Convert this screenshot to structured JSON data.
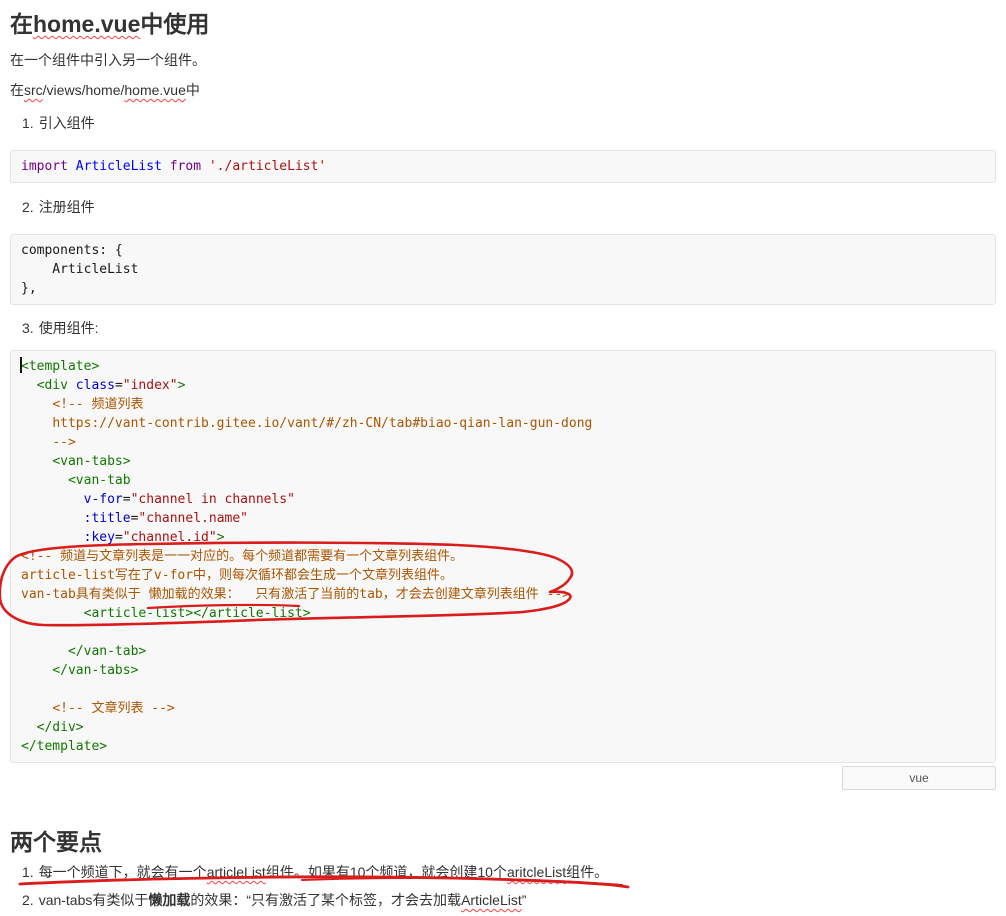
{
  "colors": {
    "annotation_red": "#d91c1c",
    "squiggle_red": "#ff4242",
    "code_bg": "#f8f8f8"
  },
  "sections": {
    "top": {
      "title_segments": [
        {
          "text": "在"
        },
        {
          "text": "home.vue",
          "squiggle": true
        },
        {
          "text": "中使用"
        }
      ],
      "intro": "在一个组件中引入另一个组件。",
      "path_segments": [
        {
          "text": "在"
        },
        {
          "text": "src",
          "squiggle": true
        },
        {
          "text": "/views/home/"
        },
        {
          "text": "home.vue",
          "squiggle": true
        },
        {
          "text": "中"
        }
      ],
      "steps": [
        {
          "marker": "1.",
          "label": "引入组件"
        },
        {
          "marker": "2.",
          "label": "注册组件"
        },
        {
          "marker": "3.",
          "label": "使用组件:"
        }
      ]
    },
    "code_blocks": {
      "import_block": {
        "lines": [
          [
            [
              "kw",
              "import"
            ],
            [
              "pl",
              " "
            ],
            [
              "def",
              "ArticleList"
            ],
            [
              "pl",
              " "
            ],
            [
              "kw",
              "from"
            ],
            [
              "pl",
              " "
            ],
            [
              "str",
              "'./articleList'"
            ]
          ]
        ]
      },
      "components_block": {
        "lines": [
          [
            [
              "pl",
              "components: {"
            ]
          ],
          [
            [
              "pl",
              "    ArticleList"
            ]
          ],
          [
            [
              "pl",
              "},"
            ]
          ]
        ]
      },
      "template_block": {
        "language_label": "vue",
        "lines": [
          [
            [
              "tag",
              "<template>"
            ]
          ],
          [
            [
              "pl",
              "  "
            ],
            [
              "tag",
              "<div"
            ],
            [
              "pl",
              " "
            ],
            [
              "attr",
              "class"
            ],
            [
              "pl",
              "="
            ],
            [
              "str",
              "\"index\""
            ],
            [
              "tag",
              ">"
            ]
          ],
          [
            [
              "pl",
              "    "
            ],
            [
              "com",
              "<!-- 频道列表"
            ]
          ],
          [
            [
              "pl",
              "    "
            ],
            [
              "com",
              "https://vant-contrib.gitee.io/vant/#/zh-CN/tab#biao-qian-lan-gun-dong"
            ]
          ],
          [
            [
              "pl",
              "    "
            ],
            [
              "com",
              "-->"
            ]
          ],
          [
            [
              "pl",
              "    "
            ],
            [
              "tag",
              "<van-tabs>"
            ]
          ],
          [
            [
              "pl",
              "      "
            ],
            [
              "tag",
              "<van-tab"
            ]
          ],
          [
            [
              "pl",
              "        "
            ],
            [
              "attr",
              "v-for"
            ],
            [
              "pl",
              "="
            ],
            [
              "str",
              "\"channel in channels\""
            ]
          ],
          [
            [
              "pl",
              "        "
            ],
            [
              "attr",
              ":title"
            ],
            [
              "pl",
              "="
            ],
            [
              "str",
              "\"channel.name\""
            ]
          ],
          [
            [
              "pl",
              "        "
            ],
            [
              "attr",
              ":key"
            ],
            [
              "pl",
              "="
            ],
            [
              "str",
              "\"channel.id\""
            ],
            [
              "tag",
              ">"
            ]
          ],
          [
            [
              "com",
              "<!-- 频道与文章列表是一一对应的。每个频道都需要有一个文章列表组件。"
            ]
          ],
          [
            [
              "com",
              "article-list写在了v-for中，则每次循环都会生成一个文章列表组件。"
            ]
          ],
          [
            [
              "com",
              "van-tab具有类似于 懒加载的效果：  只有激活了当前的tab，才会去创建文章列表组件 -->"
            ]
          ],
          [
            [
              "pl",
              "        "
            ],
            [
              "tag",
              "<article-list></article-list>"
            ]
          ],
          [
            [
              "pl",
              ""
            ]
          ],
          [
            [
              "pl",
              "      "
            ],
            [
              "tag",
              "</van-tab>"
            ]
          ],
          [
            [
              "pl",
              "    "
            ],
            [
              "tag",
              "</van-tabs>"
            ]
          ],
          [
            [
              "pl",
              ""
            ]
          ],
          [
            [
              "pl",
              "    "
            ],
            [
              "com",
              "<!-- 文章列表 -->"
            ]
          ],
          [
            [
              "pl",
              "  "
            ],
            [
              "tag",
              "</div>"
            ]
          ],
          [
            [
              "tag",
              "</template>"
            ]
          ]
        ]
      }
    },
    "bottom": {
      "title": "两个要点",
      "items": [
        {
          "marker": "1.",
          "segments": [
            {
              "text": "每一个频道下，就会有一个"
            },
            {
              "text": "articleList",
              "squiggle": true
            },
            {
              "text": "组件。如果有10个频道，就会创建10个"
            },
            {
              "text": "aritcleList",
              "squiggle": true
            },
            {
              "text": "组件。"
            }
          ]
        },
        {
          "marker": "2.",
          "segments": [
            {
              "text": "van-tabs有类似于"
            },
            {
              "text": "懒加载",
              "bold": true
            },
            {
              "text": "的效果：“只有激活了某个标签，才会去加载"
            },
            {
              "text": "ArticleList",
              "squiggle": true
            },
            {
              "text": "”"
            }
          ]
        }
      ]
    }
  }
}
